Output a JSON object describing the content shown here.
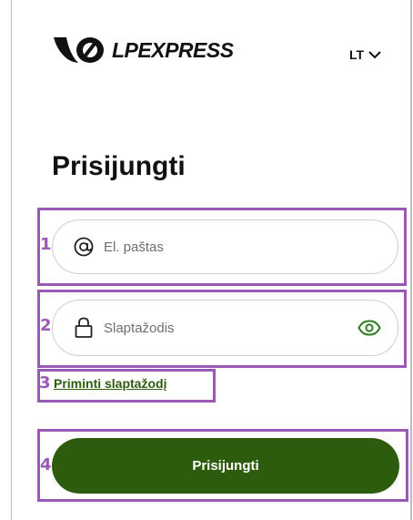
{
  "header": {
    "logo_text": "LPEXPRESS",
    "language": "LT"
  },
  "page": {
    "title": "Prisijungti"
  },
  "form": {
    "email": {
      "placeholder": "El. paštas",
      "value": ""
    },
    "password": {
      "placeholder": "Slaptažodis",
      "value": ""
    },
    "forgot_label": "Priminti slaptažodį",
    "submit_label": "Prisijungti"
  },
  "callouts": [
    "1",
    "2",
    "3",
    "4"
  ],
  "colors": {
    "brand_green": "#2e5c0e",
    "eye_green": "#2e7d1f",
    "callout_purple": "#9b59b6"
  },
  "icons": {
    "logo": "lpexpress-logo-icon",
    "language": "chevron-down-icon",
    "email": "at-sign-icon",
    "password": "lock-icon",
    "reveal": "eye-icon"
  }
}
